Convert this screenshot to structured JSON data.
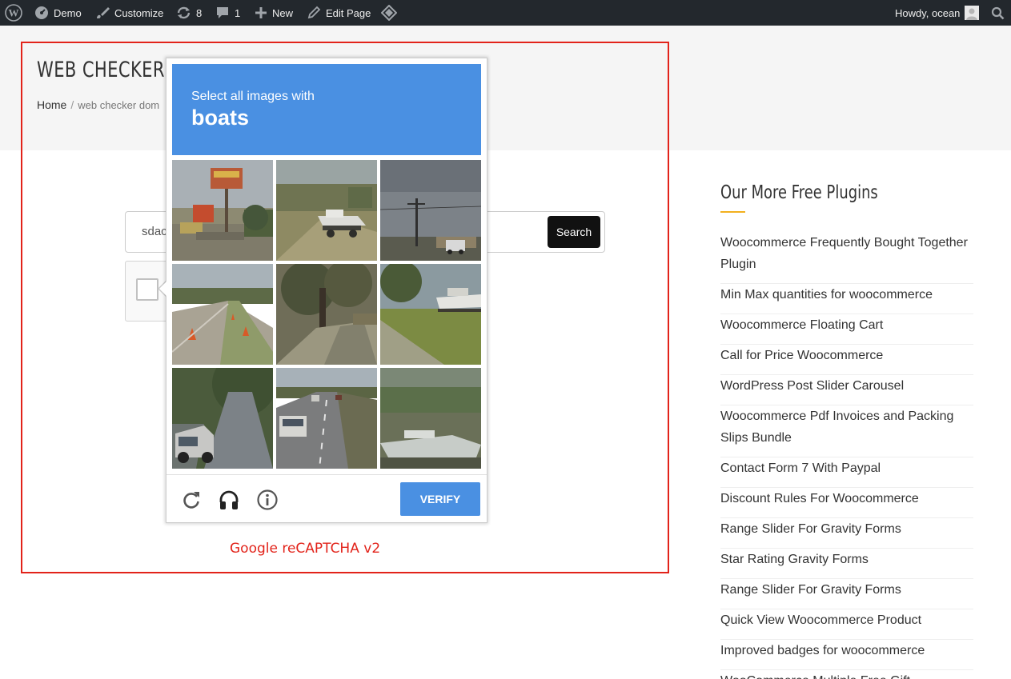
{
  "admin_bar": {
    "site_name": "Demo",
    "customize": "Customize",
    "updates_count": "8",
    "comments_count": "1",
    "new": "New",
    "edit_page": "Edit Page",
    "howdy": "Howdy, ocean",
    "icons": [
      "wordpress-logo-icon",
      "dashboard-icon",
      "brush-icon",
      "refresh-updates-icon",
      "comment-icon",
      "plus-icon",
      "pencil-icon",
      "diamond-icon",
      "avatar",
      "search-icon"
    ]
  },
  "page": {
    "title": "WEB CHECKER",
    "breadcrumb": {
      "home": "Home",
      "separator": "/",
      "current": "web checker dom"
    }
  },
  "search": {
    "value": "sdac",
    "button_label": "Search"
  },
  "recaptcha": {
    "instruction": "Select all images with",
    "keyword": "boats",
    "verify_label": "VERIFY",
    "controls": [
      "reload-icon",
      "audio-icon",
      "info-icon"
    ],
    "tiles": [
      "roadside-signs",
      "boat-on-trailer",
      "power-lines-sky",
      "road-cones",
      "tree-street",
      "boat-on-lawn",
      "car-on-street",
      "cars-on-highway",
      "boat-in-grass"
    ]
  },
  "annotation": {
    "caption": "Google reCAPTCHA v2"
  },
  "sidebar": {
    "title": "Our More Free Plugins",
    "items": [
      "Woocommerce Frequently Bought Together Plugin",
      "Min Max quantities for woocommerce",
      "Woocommerce Floating Cart",
      "Call for Price Woocommerce",
      "WordPress Post Slider Carousel",
      "Woocommerce Pdf Invoices and Packing Slips Bundle",
      "Contact Form 7 With Paypal",
      "Discount Rules For Woocommerce",
      "Range Slider For Gravity Forms",
      "Star Rating Gravity Forms",
      "Range Slider For Gravity Forms",
      "Quick View Woocommerce Product",
      "Improved badges for woocommerce",
      "WooCommerce Multiple Free Gift"
    ]
  },
  "colors": {
    "admin_bar_bg": "#23282d",
    "recaptcha_blue": "#4a90e2",
    "annotation_red": "#e2231a",
    "accent_yellow": "#f2b01e"
  }
}
